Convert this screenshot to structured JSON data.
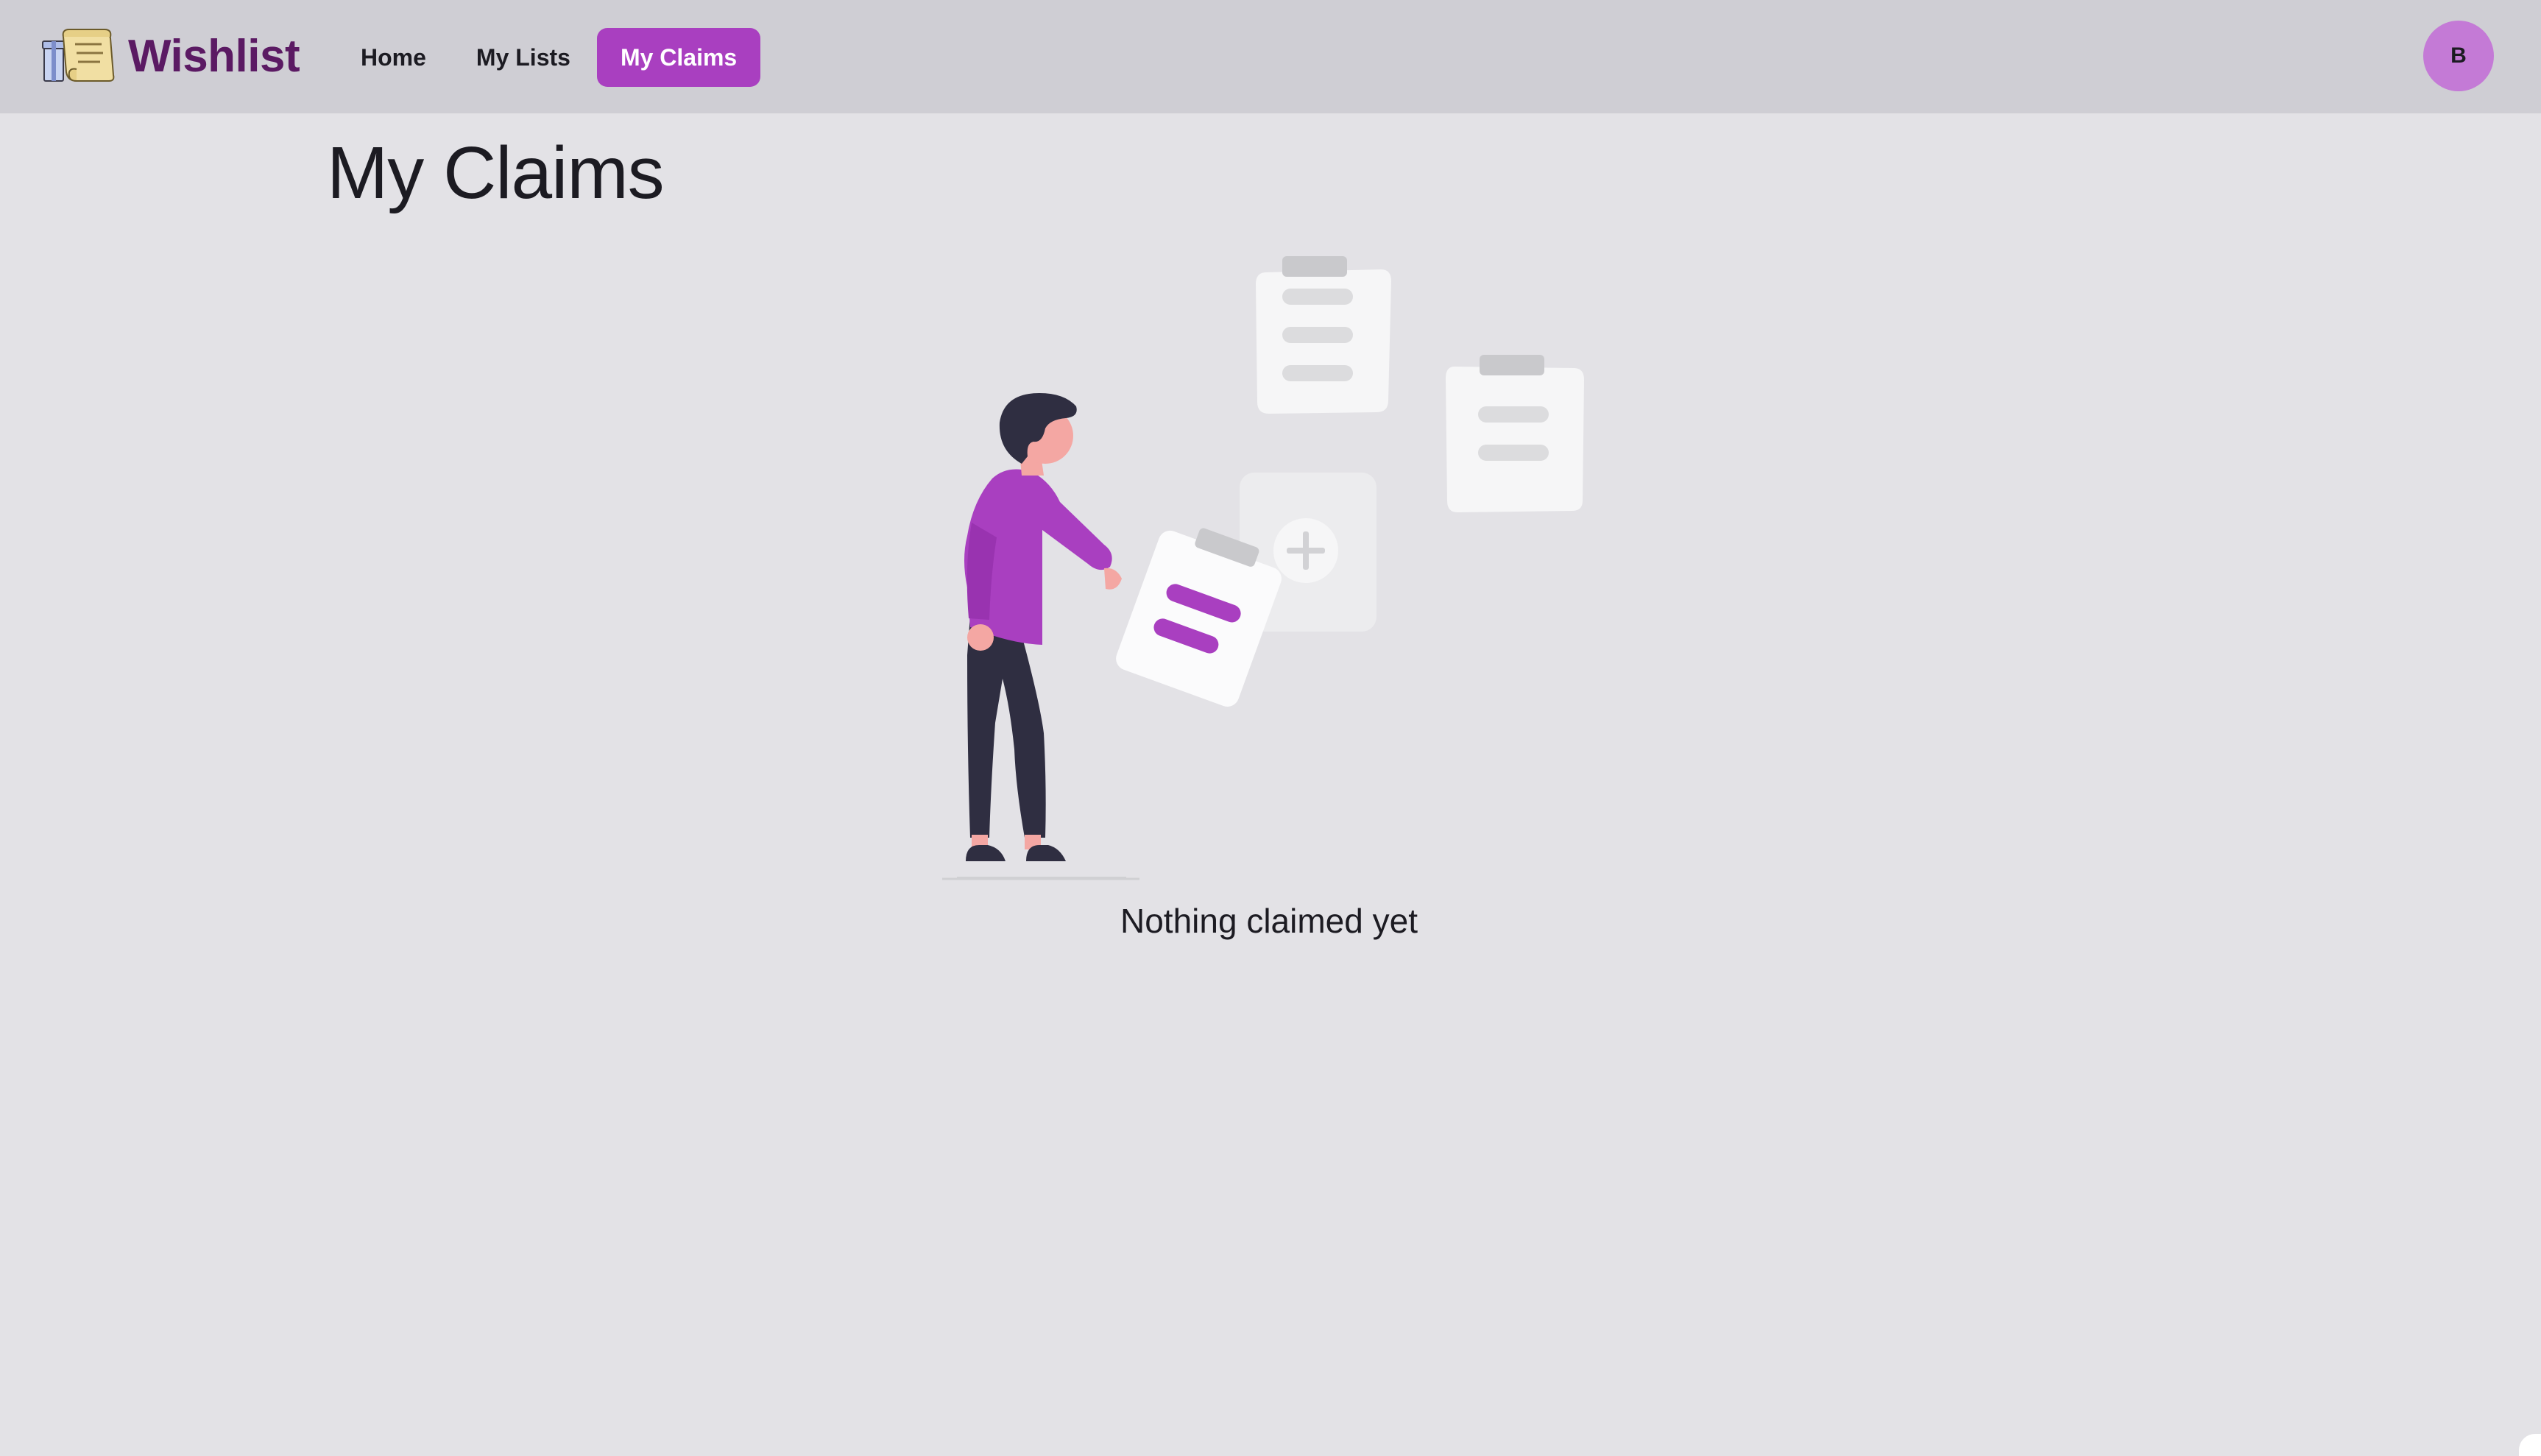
{
  "header": {
    "brand": "Wishlist",
    "nav": [
      {
        "label": "Home",
        "active": false
      },
      {
        "label": "My Lists",
        "active": false
      },
      {
        "label": "My Claims",
        "active": true
      }
    ],
    "avatar_initial": "B"
  },
  "main": {
    "title": "My Claims",
    "empty_state": {
      "illustration": "person-with-clipboards-illustration",
      "message": "Nothing claimed yet"
    }
  },
  "colors": {
    "accent": "#a93fc0",
    "brand_text": "#5b1a63",
    "avatar": "#c47ad6",
    "header_bg": "#cfced4",
    "page_bg": "#e3e2e6"
  }
}
